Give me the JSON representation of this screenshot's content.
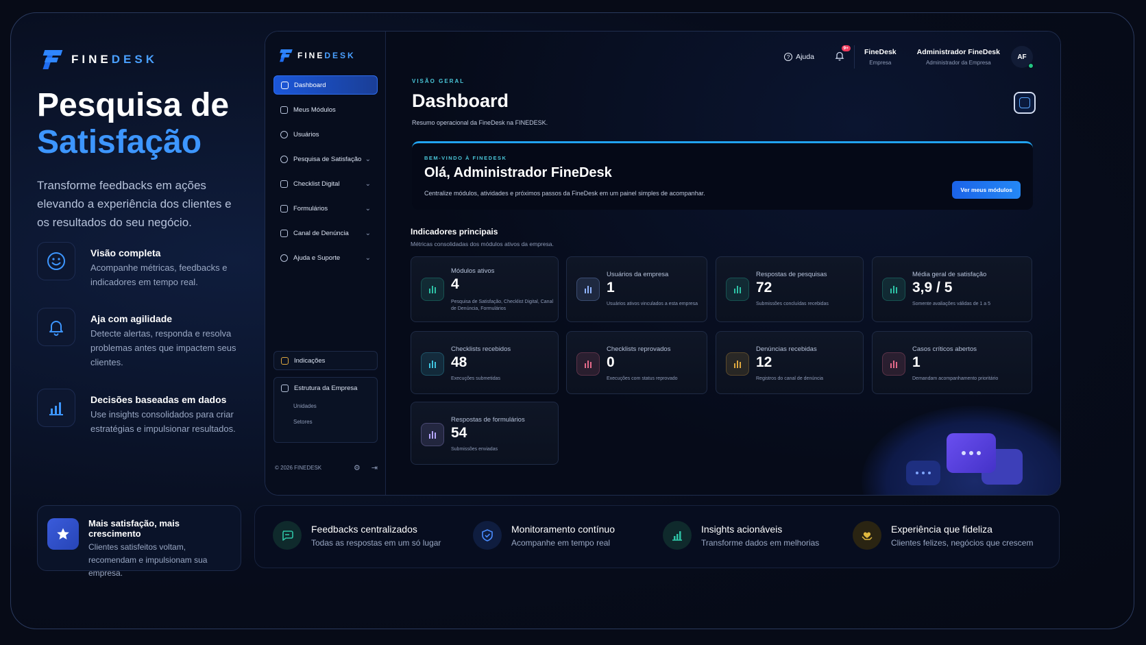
{
  "brand": {
    "name_part1": "FINE",
    "name_part2": "DESK"
  },
  "hero": {
    "title_line1": "Pesquisa de",
    "title_line2": "Satisfação",
    "description": "Transforme feedbacks em ações elevando a experiência dos clientes e os resultados do seu negócio."
  },
  "features": [
    {
      "title": "Visão completa",
      "desc": "Acompanhe métricas, feedbacks e indicadores em tempo real.",
      "icon": "smile-icon"
    },
    {
      "title": "Aja com agilidade",
      "desc": "Detecte alertas, responda e resolva problemas antes que impactem seus clientes.",
      "icon": "bell-icon"
    },
    {
      "title": "Decisões baseadas em dados",
      "desc": "Use insights consolidados para criar estratégias e impulsionar resultados.",
      "icon": "bar-chart-icon"
    }
  ],
  "promo": {
    "title": "Mais satisfação, mais crescimento",
    "desc": "Clientes satisfeitos voltam, recomendam e impulsionam sua empresa.",
    "icon": "star-icon"
  },
  "sidebar": {
    "items": [
      {
        "label": "Dashboard",
        "icon": "home-icon",
        "active": true
      },
      {
        "label": "Meus Módulos",
        "icon": "cube-icon"
      },
      {
        "label": "Usuários",
        "icon": "users-icon"
      },
      {
        "label": "Pesquisa de Satisfação",
        "icon": "smile-icon",
        "expandable": true
      },
      {
        "label": "Checklist Digital",
        "icon": "clipboard-icon",
        "expandable": true
      },
      {
        "label": "Formulários",
        "icon": "file-icon",
        "expandable": true
      },
      {
        "label": "Canal de Denúncia",
        "icon": "megaphone-icon",
        "expandable": true
      },
      {
        "label": "Ajuda e Suporte",
        "icon": "headset-icon",
        "expandable": true
      }
    ],
    "indicacoes": "Indicações",
    "structure": {
      "title": "Estrutura da Empresa",
      "sub1": "Unidades",
      "sub2": "Setores"
    },
    "footer": "© 2026 FINEDESK"
  },
  "topbar": {
    "help": "Ajuda",
    "notif_badge": "9+",
    "company_name": "FineDesk",
    "company_role": "Empresa",
    "user_name": "Administrador FineDesk",
    "user_role": "Administrador da Empresa",
    "avatar_initials": "AF"
  },
  "page": {
    "kicker": "VISÃO GERAL",
    "title": "Dashboard",
    "subtitle": "Resumo operacional da FineDesk na FINEDESK."
  },
  "welcome": {
    "kicker": "BEM-VINDO À FINEDESK",
    "heading": "Olá, Administrador FineDesk",
    "desc": "Centralize módulos, atividades e próximos passos da FineDesk em um painel simples de acompanhar.",
    "button": "Ver meus módulos"
  },
  "indicators": {
    "title": "Indicadores principais",
    "subtitle": "Métricas consolidadas dos módulos ativos da empresa.",
    "cards": [
      {
        "label": "Módulos ativos",
        "value": "4",
        "note": "Pesquisa de Satisfação, Checklist Digital, Canal de Denúncia, Formulários",
        "color": "#2ec4a6"
      },
      {
        "label": "Usuários da empresa",
        "value": "1",
        "note": "Usuários ativos vinculados a esta empresa",
        "color": "#8fb4ff"
      },
      {
        "label": "Respostas de pesquisas",
        "value": "72",
        "note": "Submissões concluídas recebidas",
        "color": "#2ec4a6"
      },
      {
        "label": "Média geral de satisfação",
        "value": "3,9 / 5",
        "note": "Somente avaliações válidas de 1 a 5",
        "color": "#2ec4a6"
      },
      {
        "label": "Checklists recebidos",
        "value": "48",
        "note": "Execuções submetidas",
        "color": "#3fc6e0"
      },
      {
        "label": "Checklists reprovados",
        "value": "0",
        "note": "Execuções com status reprovado",
        "color": "#e56a8a"
      },
      {
        "label": "Denúncias recebidas",
        "value": "12",
        "note": "Registros do canal de denúncia",
        "color": "#e0a93f"
      },
      {
        "label": "Casos críticos abertos",
        "value": "1",
        "note": "Demandam acompanhamento prioritário",
        "color": "#e56a8a"
      },
      {
        "label": "Respostas de formulários",
        "value": "54",
        "note": "Submissões enviadas",
        "color": "#b5a6ff"
      }
    ]
  },
  "strip": [
    {
      "title": "Feedbacks centralizados",
      "desc": "Todas as respostas em um só lugar",
      "icon": "chat-icon",
      "color": "#2ec4a6"
    },
    {
      "title": "Monitoramento contínuo",
      "desc": "Acompanhe em tempo real",
      "icon": "shield-icon",
      "color": "#4a8cff"
    },
    {
      "title": "Insights acionáveis",
      "desc": "Transforme dados em melhorias",
      "icon": "bar-chart-icon",
      "color": "#2ec4a6"
    },
    {
      "title": "Experiência que fideliza",
      "desc": "Clientes felizes, negócios que crescem",
      "icon": "heart-hand-icon",
      "color": "#e0b83f"
    }
  ]
}
